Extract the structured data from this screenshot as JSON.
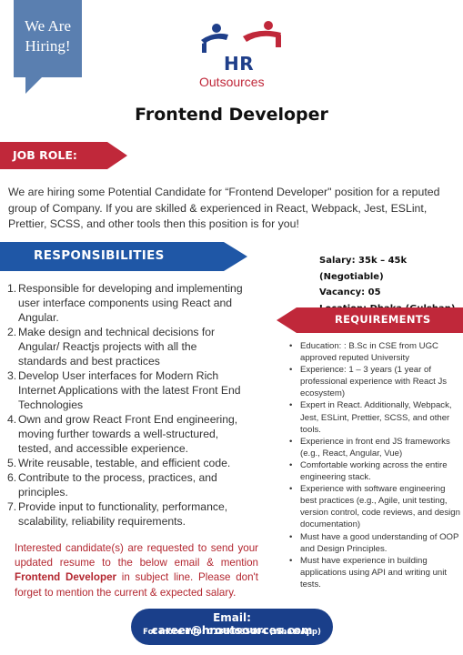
{
  "badge": {
    "line1": "We Are",
    "line2": "Hiring!"
  },
  "logo": {
    "hr": "HR",
    "outsources": "Outsources"
  },
  "title": "Frontend Developer",
  "job_role": {
    "heading": "JOB ROLE:"
  },
  "intro": "We are hiring some Potential Candidate for “Frontend Developer\" position for a reputed group of Company. If you are skilled & experienced in React, Webpack, Jest, ESLint, Prettier, SCSS, and other tools then this position is for you!",
  "responsibilities": {
    "heading": "RESPONSIBILITIES",
    "items": [
      {
        "num": "1.",
        "text": "Responsible for developing and implementing user interface components using React and Angular."
      },
      {
        "num": "2.",
        "text": "Make design and technical decisions for Angular/ Reactjs projects with all the standards and best practices"
      },
      {
        "num": "3.",
        "text": "Develop User interfaces for Modern Rich Internet Applications with the latest Front End Technologies"
      },
      {
        "num": "4.",
        "text": "Own and grow React Front End engineering, moving further towards a well-structured, tested, and accessible experience."
      },
      {
        "num": "5.",
        "text": "Write reusable, testable, and efficient code."
      },
      {
        "num": "6.",
        "text": "Contribute to the process, practices, and principles."
      },
      {
        "num": "7.",
        "text": "Provide input to functionality, performance, scalability, reliability requirements."
      }
    ]
  },
  "meta": {
    "salary": "Salary: 35k – 45k (Negotiable)",
    "vacancy": "Vacancy: 05",
    "location": "Location: Dhaka (Gulshan)"
  },
  "requirements": {
    "heading": "REQUIREMENTS",
    "items": [
      "Education: : B.Sc in CSE from UGC approved reputed University",
      "Experience: 1 – 3 years (1 year of professional experience with React Js ecosystem)",
      "Expert in React. Additionally, Webpack, Jest, ESLint, Prettier, SCSS, and other tools.",
      "Experience in front end JS frameworks (e.g., React, Angular, Vue)",
      "Comfortable working across the entire engineering stack.",
      "Experience with software engineering best practices (e.g., Agile, unit testing, version control, code reviews, and design documentation)",
      "Must have a good understanding of OOP and Design Principles.",
      "Must have experience in building applications using API and writing unit tests."
    ]
  },
  "note": {
    "part1": "Interested candidate(s) are requested to send your updated resume to the below email & mention ",
    "bold": "Frontend Developer",
    "part2": " in subject line. Please don't forget to mention the current & expected salary."
  },
  "contact": {
    "email": "Email: career@hroutsources.com",
    "info": "For more info: 01880085404 (WhatsApp)"
  },
  "colors": {
    "blue": "#1f57a6",
    "navy": "#1a3f8a",
    "red": "#c0283a",
    "badge": "#5a7fb0"
  }
}
